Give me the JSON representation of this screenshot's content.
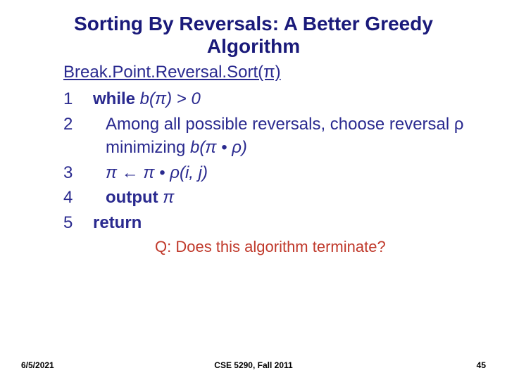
{
  "title": "Sorting By Reversals: A Better Greedy Algorithm",
  "func_name": "Break.Point.Reversal.Sort(π)",
  "lines": {
    "l1": {
      "num": "1",
      "kw": "while",
      "rest": " b(π) > 0"
    },
    "l2": {
      "num": "2",
      "text_a": "Among all possible reversals, choose reversal  ρ  minimizing ",
      "text_b": "b(π • ρ)"
    },
    "l3": {
      "num": "3",
      "text": "π ← π • ρ(i, j)"
    },
    "l4": {
      "num": "4",
      "kw": "output",
      "rest": " π"
    },
    "l5": {
      "num": "5",
      "kw": "return"
    }
  },
  "question": "Q: Does this algorithm terminate?",
  "footer": {
    "left": "6/5/2021",
    "center": "CSE 5290, Fall 2011",
    "right": "45"
  }
}
